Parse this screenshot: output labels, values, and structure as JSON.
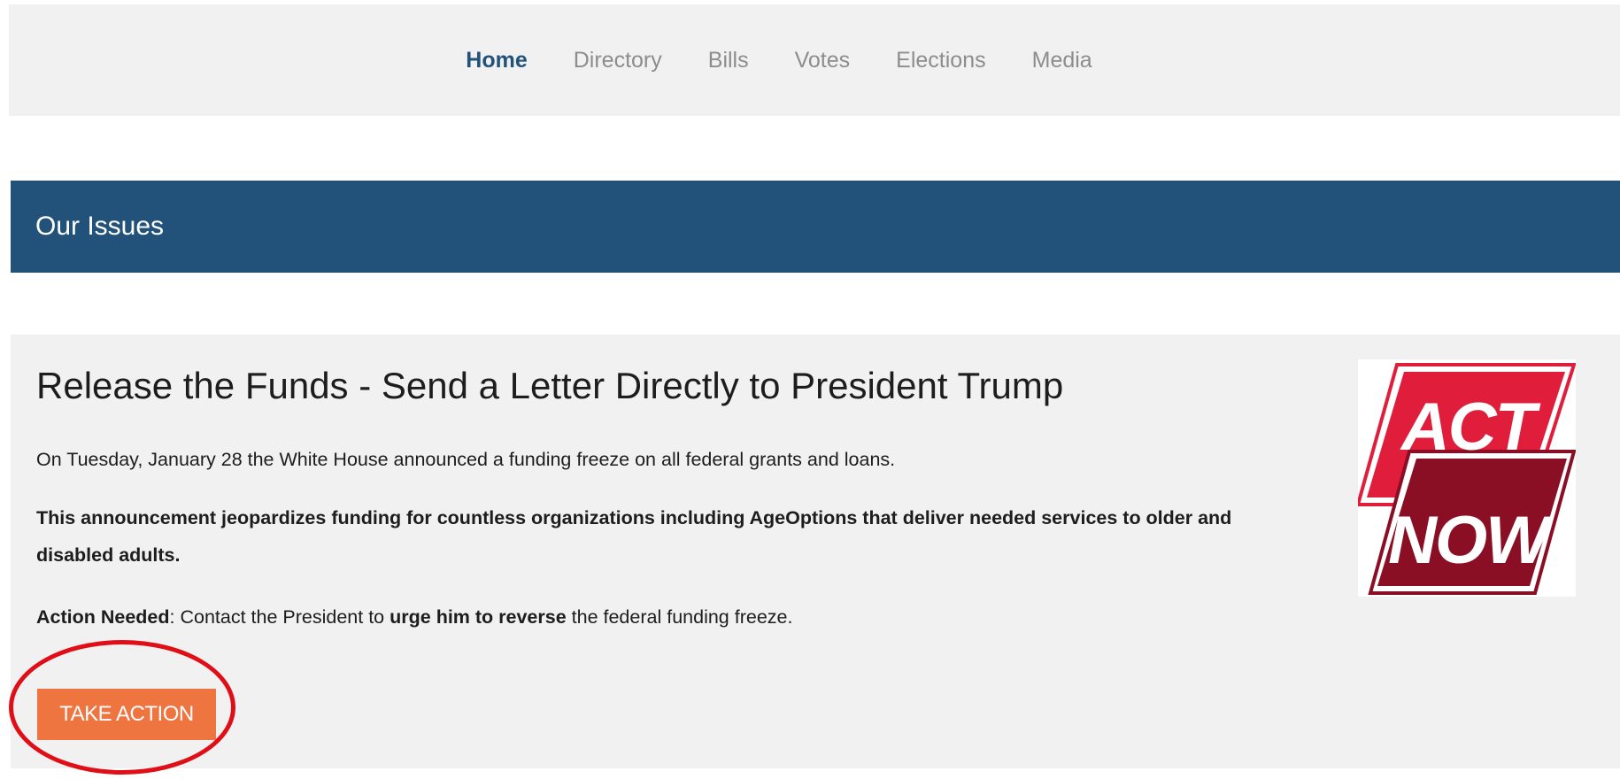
{
  "nav": {
    "items": [
      {
        "label": "Home",
        "active": true
      },
      {
        "label": "Directory",
        "active": false
      },
      {
        "label": "Bills",
        "active": false
      },
      {
        "label": "Votes",
        "active": false
      },
      {
        "label": "Elections",
        "active": false
      },
      {
        "label": "Media",
        "active": false
      }
    ]
  },
  "section": {
    "title": "Our Issues"
  },
  "issue": {
    "title": "Release the Funds - Send a Letter Directly to President Trump",
    "paragraph1": "On Tuesday, January 28 the White House announced a funding freeze on all federal grants and loans.",
    "paragraph2": "This announcement jeopardizes funding for countless organizations including AgeOptions that deliver needed services to older and disabled adults.",
    "action": {
      "label_bold": "Action Needed",
      "text_1": ": Contact the President to ",
      "emphasis": "urge him to reverse",
      "text_2": " the federal funding freeze."
    },
    "button_label": "TAKE ACTION",
    "badge": {
      "line1": "ACT",
      "line2": "NOW"
    }
  },
  "colors": {
    "nav_active": "#22527a",
    "nav_inactive": "#8d8d8d",
    "banner": "#22527a",
    "card_bg": "#f1f1f1",
    "button": "#ee7440",
    "highlight_ring": "#e00e16",
    "badge_red": "#e01e3c",
    "badge_dark_red": "#8a0f24"
  }
}
